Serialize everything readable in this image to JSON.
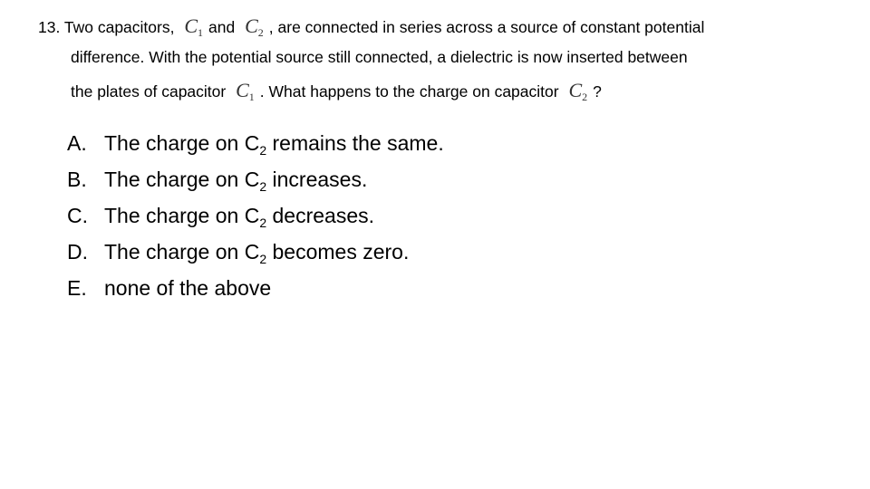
{
  "question": {
    "number": "13.",
    "line1_a": "Two capacitors,",
    "c1_symbol": "C",
    "c1_sub": "1",
    "line1_b": "and",
    "c2_symbol": "C",
    "c2_sub": "2",
    "line1_c": ", are connected in series across a source of constant potential",
    "line2": "difference. With the potential source still connected, a dielectric is now inserted between",
    "line3_a": "the plates of capacitor",
    "line3_c1_symbol": "C",
    "line3_c1_sub": "1",
    "line3_b": ". What happens to the charge on capacitor",
    "line3_c2_symbol": "C",
    "line3_c2_sub": "2",
    "line3_c": "?"
  },
  "options": [
    {
      "letter": "A.",
      "pre": "The charge on C",
      "sub": "2",
      "post": " remains the same."
    },
    {
      "letter": "B.",
      "pre": "The charge on C",
      "sub": "2",
      "post": " increases."
    },
    {
      "letter": "C.",
      "pre": "The charge on C",
      "sub": "2",
      "post": " decreases."
    },
    {
      "letter": "D.",
      "pre": "The charge on C",
      "sub": "2",
      "post": " becomes zero."
    },
    {
      "letter": "E.",
      "pre": "none of the above",
      "sub": "",
      "post": ""
    }
  ]
}
